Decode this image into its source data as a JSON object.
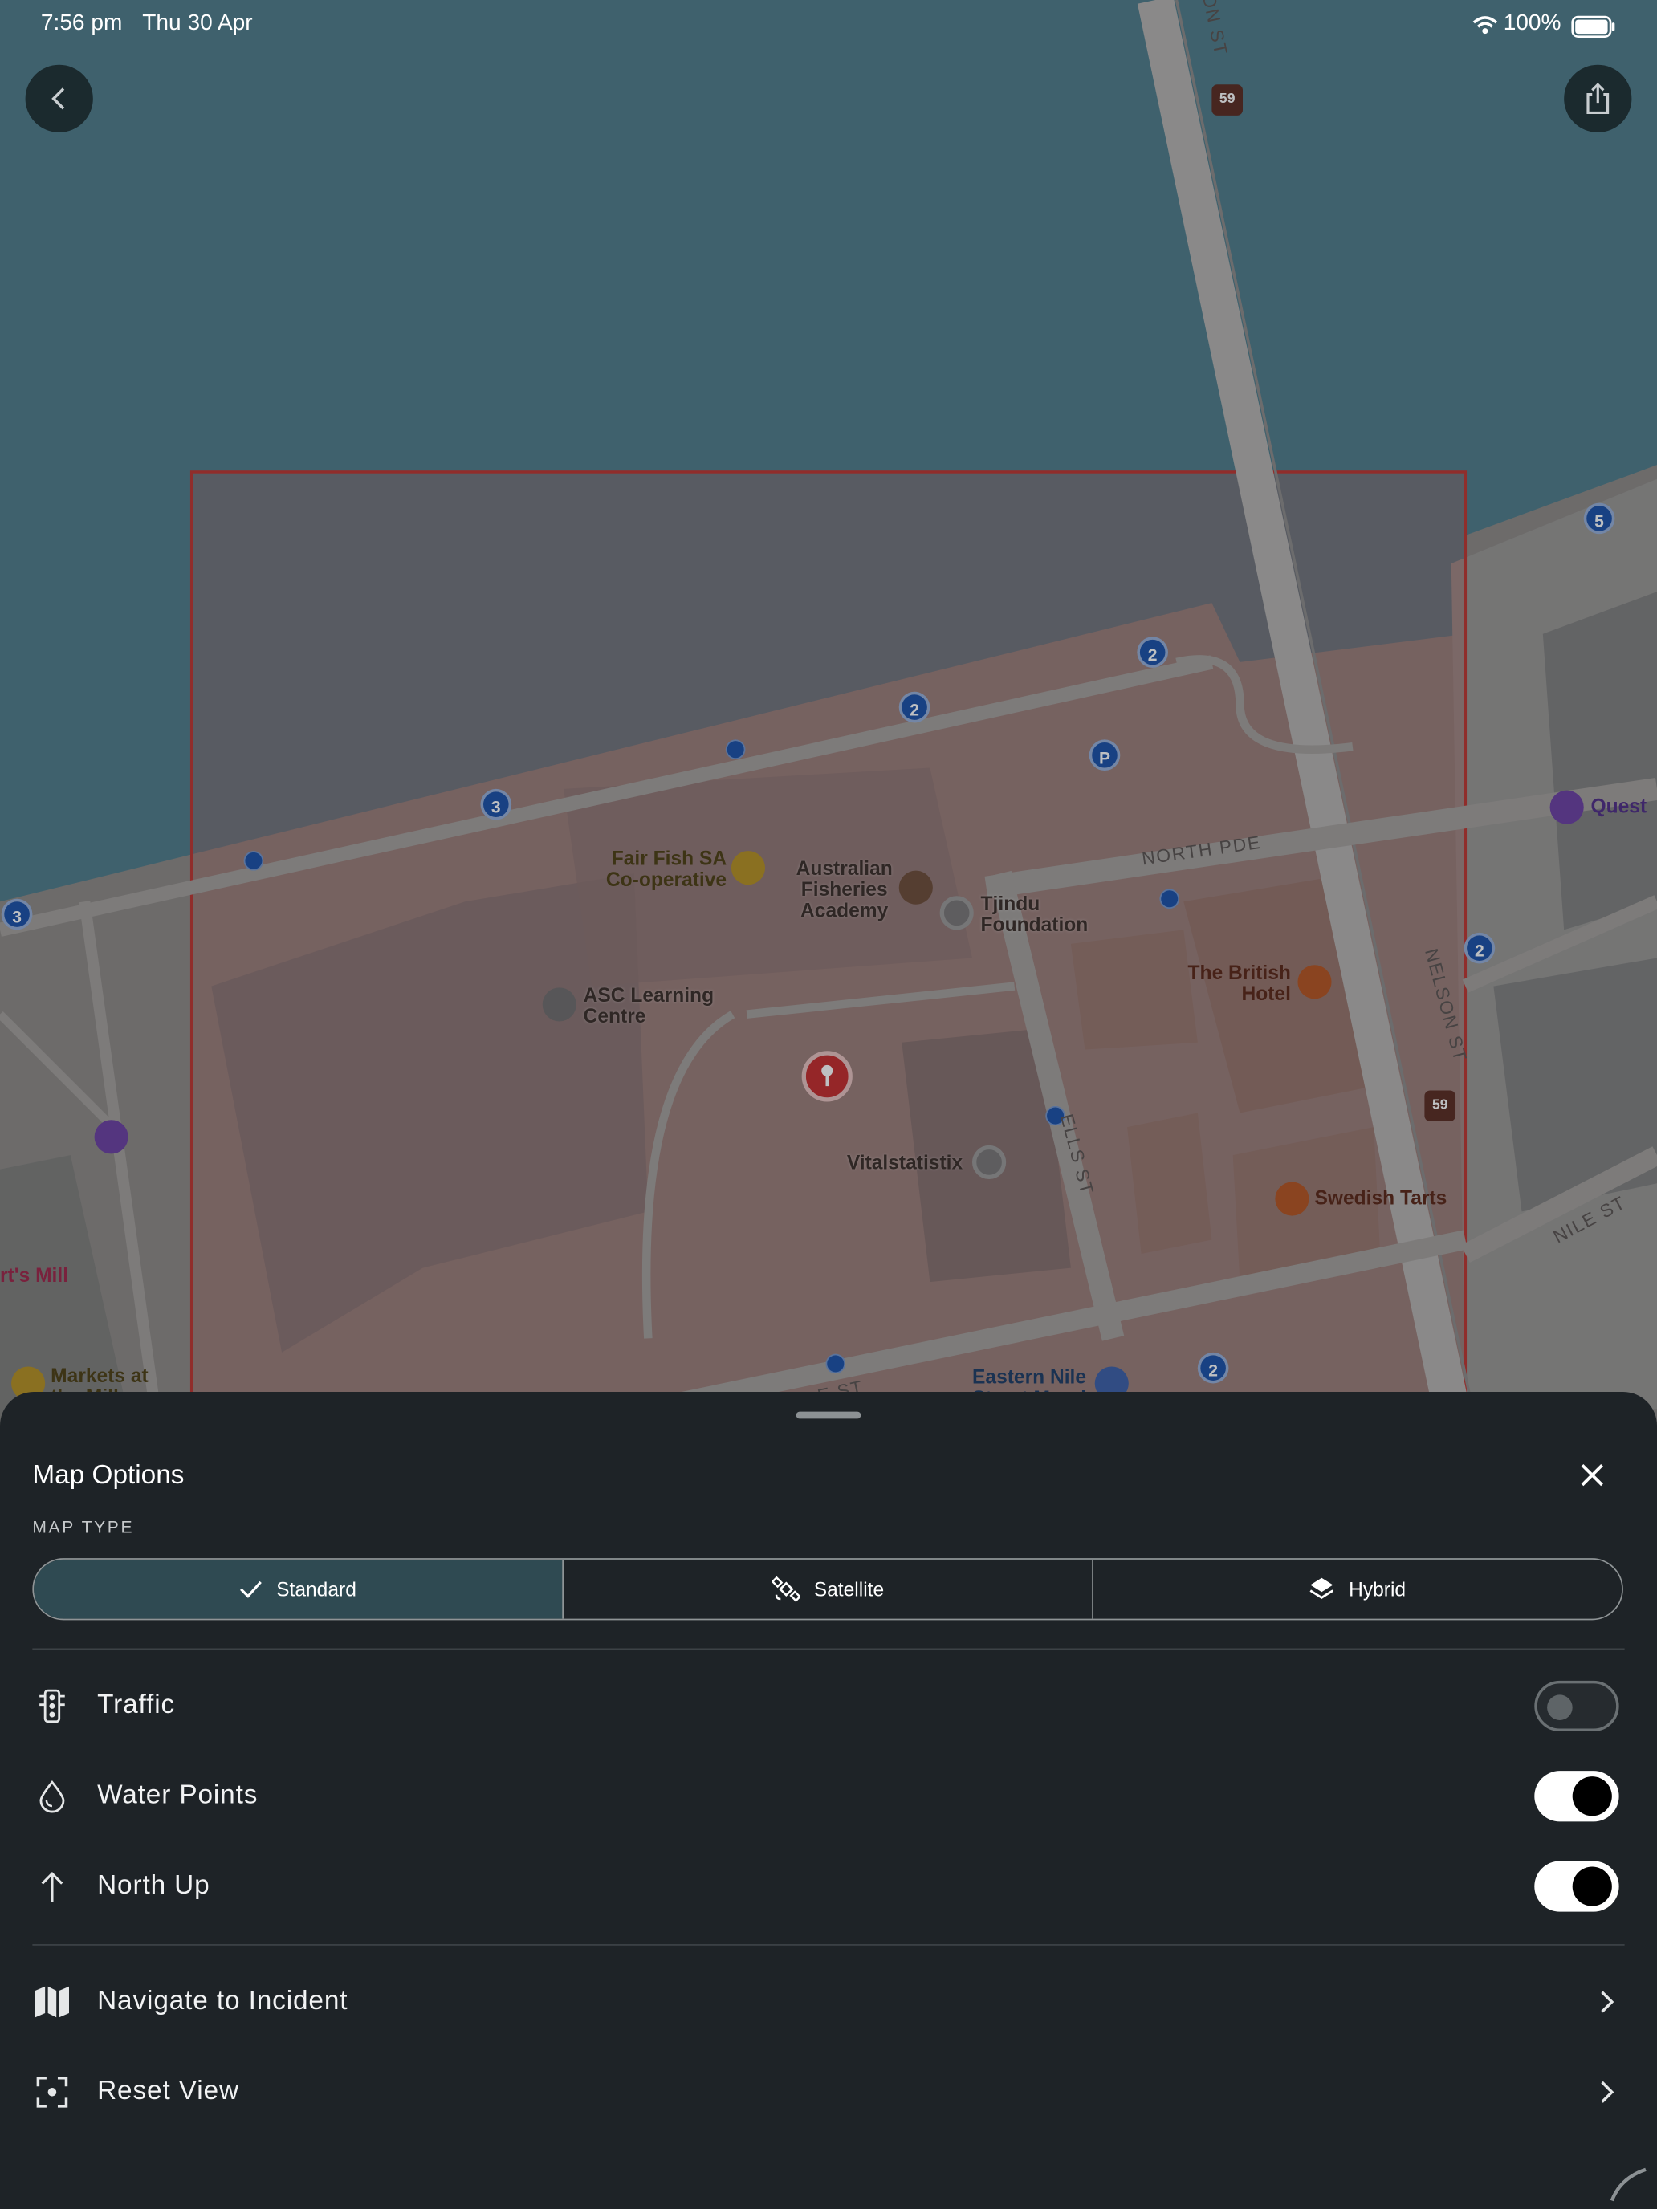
{
  "status_bar": {
    "time": "7:56 pm",
    "date": "Thu 30 Apr",
    "battery": "100%"
  },
  "map": {
    "labels": {
      "fair_fish_line1": "Fair Fish SA",
      "fair_fish_line2": "Co-operative",
      "afa_line1": "Australian",
      "afa_line2": "Fisheries",
      "afa_line3": "Academy",
      "tjindu_line1": "Tjindu",
      "tjindu_line2": "Foundation",
      "asc_line1": "ASC Learning",
      "asc_line2": "Centre",
      "british_line1": "The British",
      "british_line2": "Hotel",
      "vitalstatistix": "Vitalstatistix",
      "swedish_tarts": "Swedish Tarts",
      "eastern_nile_line1": "Eastern Nile",
      "eastern_nile_line2": "Street Murals",
      "quest": "Quest",
      "mill": "rt's Mill",
      "markets_line1": "Markets at",
      "markets_line2": "the Mill"
    },
    "streets": {
      "north_pde": "NORTH PDE",
      "nelson_st": "NELSON ST",
      "nelson_top": "ON ST",
      "wells_st": "ELLS ST",
      "nile_st": "NILE ST",
      "e_st": "E ST"
    },
    "cluster_pins": [
      {
        "value": "3",
        "color": "#1a4fa8"
      },
      {
        "value": "3",
        "color": "#1a4fa8"
      },
      {
        "value": "2",
        "color": "#1a4fa8"
      },
      {
        "value": "2",
        "color": "#1a4fa8"
      },
      {
        "value": "2",
        "color": "#1a4fa8"
      },
      {
        "value": "2",
        "color": "#1a4fa8"
      },
      {
        "value": "5",
        "color": "#1a4fa8"
      }
    ],
    "parking_label": "P",
    "route_shield": "59",
    "incident_area_color": "#c0342f",
    "incident_pin_color": "#c72a2a"
  },
  "sheet": {
    "title": "Map Options",
    "map_type_heading": "MAP TYPE",
    "map_types": [
      {
        "label": "Standard",
        "icon": "checkmark-icon",
        "selected": true
      },
      {
        "label": "Satellite",
        "icon": "satellite-icon",
        "selected": false
      },
      {
        "label": "Hybrid",
        "icon": "layers-icon",
        "selected": false
      }
    ],
    "toggles": [
      {
        "label": "Traffic",
        "icon": "traffic-light-icon",
        "on": false
      },
      {
        "label": "Water Points",
        "icon": "water-drop-icon",
        "on": true
      },
      {
        "label": "North Up",
        "icon": "north-arrow-icon",
        "on": true
      }
    ],
    "actions": [
      {
        "label": "Navigate to Incident",
        "icon": "map-icon"
      },
      {
        "label": "Reset View",
        "icon": "reset-view-icon"
      }
    ]
  },
  "colors": {
    "water": "#4f7c8a",
    "sheet_bg": "#1e2327",
    "selected_segment": "#2f4a52"
  }
}
